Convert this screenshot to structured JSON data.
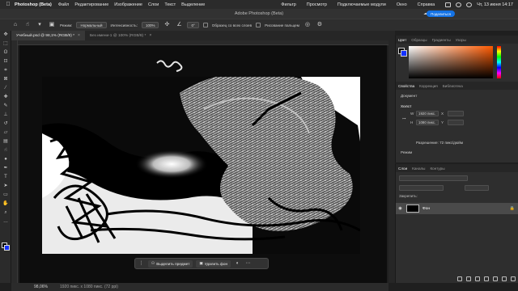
{
  "menubar": {
    "app_name": "Photoshop (Beta)",
    "items": [
      "Файл",
      "Редактирование",
      "Изображение",
      "Слои",
      "Текст",
      "Выделение"
    ],
    "right_items": [
      "Фильтр",
      "Просмотр",
      "Подключаемые модули",
      "Окно",
      "Справка"
    ],
    "clock": "Чт, 13 июня  14:17"
  },
  "titlebar": {
    "title": "Adobe Photoshop (Beta)",
    "share_label": "Поделиться"
  },
  "options": {
    "mode_label": "Режим:",
    "mode_value": "Нормальный",
    "flow_label": "Интенсивность:",
    "flow_value": "100%",
    "angle_value": "0°",
    "sample_all_label": "Образец со всех слоев",
    "finger_label": "Рисование пальцем"
  },
  "tabs": [
    {
      "label": "Учебный.psd @ 98,1% (RGB/8) *",
      "active": true
    },
    {
      "label": "Без имени-1 @ 100% (RGB/8) *",
      "active": false
    }
  ],
  "context_bar": {
    "select_subject": "Выделить предмет",
    "remove_bg": "Удалить фон"
  },
  "status": {
    "zoom": "98,06%",
    "dimensions": "1920 пикс. x 1080 пикс. (72 ppi)"
  },
  "color_panel": {
    "tabs": [
      "Цвет",
      "Образцы",
      "Градиенты",
      "Узоры"
    ],
    "fg_color": "#000000",
    "bg_color": "#1432ff"
  },
  "properties_panel": {
    "tabs": [
      "Свойства",
      "Коррекция",
      "Библиотека"
    ],
    "doc_label": "Документ",
    "canvas_label": "Холст",
    "width_value": "1920 пикс.",
    "width_unit": "X",
    "height_value": "1080 пикс.",
    "height_unit": "Y",
    "resolution": "Разрешение: 72 пикс/дюйм",
    "mode_label": "Режим"
  },
  "layers_panel": {
    "tabs": [
      "Слои",
      "Каналы",
      "Контуры"
    ],
    "blend_label": "Обычные",
    "opacity_label": "Непрозр.:",
    "lock_label": "Закрепить:",
    "layers": [
      {
        "name": "Фон",
        "locked": true
      }
    ]
  }
}
